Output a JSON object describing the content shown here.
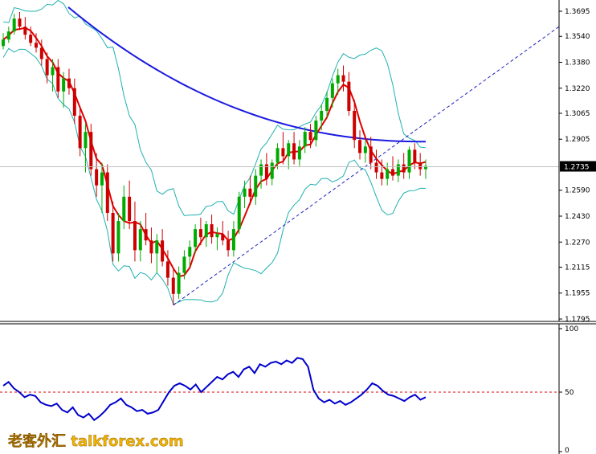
{
  "chart_data": [
    {
      "type": "candlestick",
      "panel": "price",
      "y_ticks": [
        "1.3695",
        "1.3540",
        "1.3380",
        "1.3220",
        "1.3065",
        "1.2905",
        "1.2590",
        "1.2430",
        "1.2270",
        "1.2115",
        "1.1955",
        "1.1795"
      ],
      "y_range": [
        1.1795,
        1.372
      ],
      "current_price": "1.2735",
      "current_price_value": 1.2735,
      "candles": [
        [
          1.348,
          1.356,
          1.346,
          1.352
        ],
        [
          1.352,
          1.36,
          1.35,
          1.357
        ],
        [
          1.357,
          1.368,
          1.355,
          1.365
        ],
        [
          1.365,
          1.369,
          1.358,
          1.36
        ],
        [
          1.36,
          1.366,
          1.352,
          1.355
        ],
        [
          1.355,
          1.36,
          1.348,
          1.35
        ],
        [
          1.35,
          1.356,
          1.344,
          1.347
        ],
        [
          1.347,
          1.352,
          1.336,
          1.34
        ],
        [
          1.34,
          1.344,
          1.325,
          1.33
        ],
        [
          1.33,
          1.34,
          1.32,
          1.335
        ],
        [
          1.335,
          1.34,
          1.316,
          1.32
        ],
        [
          1.32,
          1.332,
          1.31,
          1.328
        ],
        [
          1.328,
          1.334,
          1.318,
          1.322
        ],
        [
          1.322,
          1.328,
          1.3,
          1.305
        ],
        [
          1.305,
          1.31,
          1.28,
          1.285
        ],
        [
          1.285,
          1.3,
          1.27,
          1.295
        ],
        [
          1.295,
          1.3,
          1.268,
          1.272
        ],
        [
          1.272,
          1.282,
          1.255,
          1.262
        ],
        [
          1.262,
          1.276,
          1.245,
          1.27
        ],
        [
          1.27,
          1.275,
          1.24,
          1.245
        ],
        [
          1.245,
          1.252,
          1.215,
          1.22
        ],
        [
          1.22,
          1.245,
          1.215,
          1.24
        ],
        [
          1.24,
          1.262,
          1.235,
          1.255
        ],
        [
          1.255,
          1.265,
          1.235,
          1.24
        ],
        [
          1.24,
          1.252,
          1.215,
          1.222
        ],
        [
          1.222,
          1.24,
          1.215,
          1.235
        ],
        [
          1.235,
          1.245,
          1.225,
          1.228
        ],
        [
          1.228,
          1.236,
          1.214,
          1.22
        ],
        [
          1.22,
          1.232,
          1.208,
          1.228
        ],
        [
          1.228,
          1.235,
          1.212,
          1.215
        ],
        [
          1.215,
          1.222,
          1.2,
          1.205
        ],
        [
          1.205,
          1.21,
          1.188,
          1.195
        ],
        [
          1.195,
          1.212,
          1.192,
          1.208
        ],
        [
          1.208,
          1.222,
          1.204,
          1.218
        ],
        [
          1.218,
          1.228,
          1.212,
          1.224
        ],
        [
          1.224,
          1.238,
          1.22,
          1.235
        ],
        [
          1.235,
          1.242,
          1.225,
          1.23
        ],
        [
          1.23,
          1.24,
          1.224,
          1.238
        ],
        [
          1.238,
          1.244,
          1.226,
          1.23
        ],
        [
          1.23,
          1.236,
          1.222,
          1.232
        ],
        [
          1.232,
          1.24,
          1.225,
          1.228
        ],
        [
          1.228,
          1.234,
          1.218,
          1.222
        ],
        [
          1.222,
          1.24,
          1.218,
          1.235
        ],
        [
          1.235,
          1.258,
          1.232,
          1.255
        ],
        [
          1.255,
          1.265,
          1.248,
          1.26
        ],
        [
          1.26,
          1.268,
          1.25,
          1.255
        ],
        [
          1.255,
          1.272,
          1.25,
          1.268
        ],
        [
          1.268,
          1.278,
          1.26,
          1.275
        ],
        [
          1.275,
          1.282,
          1.262,
          1.266
        ],
        [
          1.266,
          1.278,
          1.262,
          1.276
        ],
        [
          1.276,
          1.288,
          1.272,
          1.285
        ],
        [
          1.285,
          1.295,
          1.275,
          1.28
        ],
        [
          1.28,
          1.29,
          1.272,
          1.288
        ],
        [
          1.288,
          1.295,
          1.275,
          1.278
        ],
        [
          1.278,
          1.29,
          1.274,
          1.286
        ],
        [
          1.286,
          1.298,
          1.282,
          1.295
        ],
        [
          1.295,
          1.3,
          1.285,
          1.29
        ],
        [
          1.29,
          1.305,
          1.286,
          1.302
        ],
        [
          1.302,
          1.312,
          1.296,
          1.308
        ],
        [
          1.308,
          1.32,
          1.304,
          1.316
        ],
        [
          1.316,
          1.328,
          1.31,
          1.325
        ],
        [
          1.325,
          1.334,
          1.318,
          1.33
        ],
        [
          1.33,
          1.336,
          1.32,
          1.326
        ],
        [
          1.326,
          1.332,
          1.305,
          1.308
        ],
        [
          1.308,
          1.315,
          1.285,
          1.29
        ],
        [
          1.29,
          1.296,
          1.278,
          1.282
        ],
        [
          1.282,
          1.29,
          1.276,
          1.286
        ],
        [
          1.286,
          1.292,
          1.272,
          1.276
        ],
        [
          1.276,
          1.284,
          1.266,
          1.27
        ],
        [
          1.27,
          1.278,
          1.262,
          1.266
        ],
        [
          1.266,
          1.276,
          1.262,
          1.272
        ],
        [
          1.272,
          1.28,
          1.265,
          1.268
        ],
        [
          1.268,
          1.278,
          1.264,
          1.275
        ],
        [
          1.275,
          1.282,
          1.266,
          1.27
        ],
        [
          1.27,
          1.286,
          1.266,
          1.284
        ],
        [
          1.284,
          1.288,
          1.272,
          1.276
        ],
        [
          1.276,
          1.282,
          1.268,
          1.272
        ],
        [
          1.272,
          1.278,
          1.266,
          1.274
        ]
      ],
      "overlays": [
        "Bollinger Bands",
        "Moving Average (fast)",
        "Moving Average (slow)",
        "Trendline"
      ]
    },
    {
      "type": "line",
      "panel": "oscillator",
      "y_ticks": [
        "100",
        "50",
        "0"
      ],
      "y_range": [
        0,
        100
      ],
      "reference_level": 50,
      "values": [
        55,
        58,
        53,
        50,
        46,
        48,
        47,
        42,
        40,
        39,
        41,
        36,
        34,
        38,
        32,
        30,
        33,
        28,
        31,
        35,
        40,
        42,
        45,
        40,
        38,
        35,
        36,
        33,
        34,
        36,
        43,
        50,
        55,
        57,
        55,
        52,
        56,
        50,
        54,
        58,
        62,
        60,
        64,
        66,
        62,
        68,
        70,
        65,
        72,
        70,
        73,
        74,
        72,
        75,
        73,
        77,
        76,
        70,
        52,
        45,
        42,
        44,
        41,
        43,
        40,
        42,
        45,
        48,
        52,
        57,
        55,
        51,
        48,
        47,
        45,
        43,
        46,
        48,
        44,
        46
      ]
    }
  ],
  "watermark": "老客外汇 talkforex.com"
}
